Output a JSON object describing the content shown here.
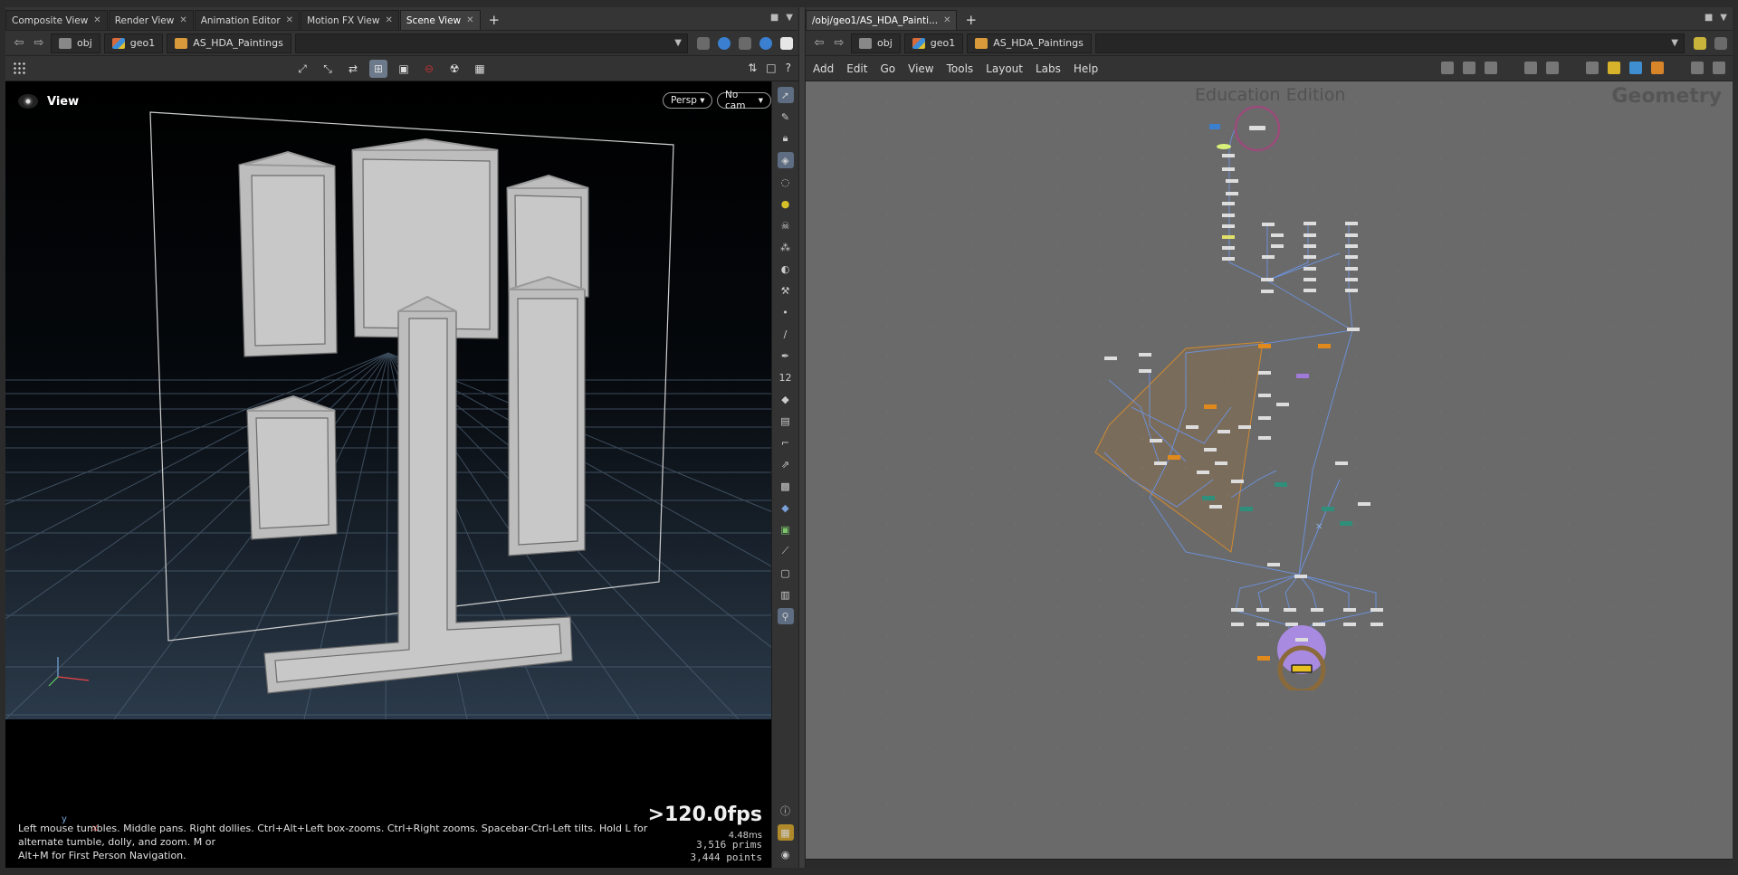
{
  "left_pane": {
    "tabs": [
      {
        "label": "Composite View"
      },
      {
        "label": "Render View"
      },
      {
        "label": "Animation Editor"
      },
      {
        "label": "Motion FX View"
      },
      {
        "label": "Scene View",
        "active": true
      }
    ],
    "breadcrumbs": [
      "obj",
      "geo1",
      "AS_HDA_Paintings"
    ],
    "viewport": {
      "title": "View",
      "camera_mode": "Persp",
      "camera": "No cam",
      "fps": ">120.0fps",
      "frame_time": "4.48ms",
      "prims": "3,516  prims",
      "points": "3,444  points",
      "hint_line1": "Left mouse tumbles. Middle pans. Right dollies. Ctrl+Alt+Left box-zooms. Ctrl+Right zooms. Spacebar-Ctrl-Left tilts. Hold L for alternate tumble, dolly, and zoom. M or",
      "hint_line2": "Alt+M for First Person Navigation.",
      "axis_x": "x",
      "axis_y": "y"
    }
  },
  "right_pane": {
    "tab": "/obj/geo1/AS_HDA_Painti...",
    "breadcrumbs": [
      "obj",
      "geo1",
      "AS_HDA_Paintings"
    ],
    "menu": [
      "Add",
      "Edit",
      "Go",
      "View",
      "Tools",
      "Layout",
      "Labs",
      "Help"
    ],
    "watermark": "Education Edition",
    "context_label": "Geometry"
  },
  "colors": {
    "accent_blue": "#6c8fd6",
    "node_orange": "#e08a1e",
    "node_purple": "#a07ad8",
    "node_teal": "#2f8f7a",
    "net_bg": "#3a3a3a"
  }
}
